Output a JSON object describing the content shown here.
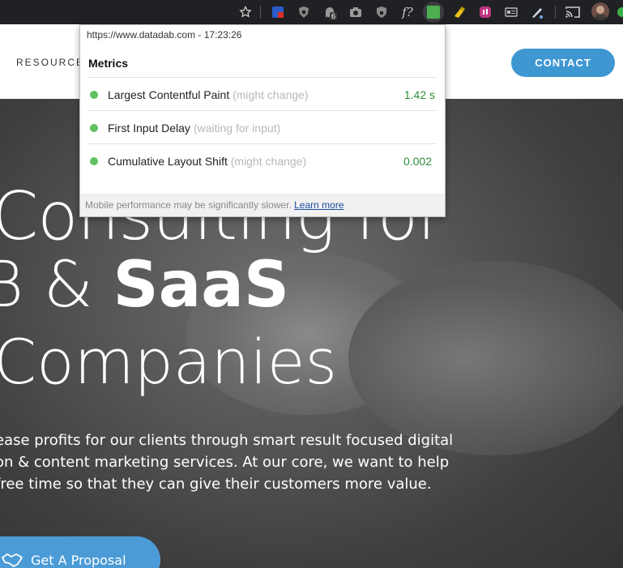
{
  "toolbar": {
    "icons": [
      "star-icon",
      "ublock-icon",
      "shield-icon",
      "ghostery-icon",
      "camera-icon",
      "privacy-shield-icon",
      "font-inspector-icon",
      "web-vitals-icon",
      "highlighter-icon",
      "instagram-icon",
      "reader-icon",
      "pen-icon",
      "cast-icon",
      "profile-avatar"
    ],
    "badge": "6",
    "font_ext": "f?"
  },
  "header": {
    "nav_resources": "RESOURCES",
    "contact": "CONTACT"
  },
  "popup": {
    "url": "https://www.datadab.com - 17:23:26",
    "heading": "Metrics",
    "metrics": [
      {
        "name": "Largest Contentful Paint",
        "note": "(might change)",
        "value": "1.42 s"
      },
      {
        "name": "First Input Delay",
        "note": "(waiting for input)",
        "value": ""
      },
      {
        "name": "Cumulative Layout Shift",
        "note": "(might change)",
        "value": "0.002"
      }
    ],
    "footer_text": "Mobile performance may be significantly slower.",
    "footer_link": "Learn more"
  },
  "hero": {
    "line1": "Consulting for",
    "line2_pre": "B & ",
    "line2_bold": "SaaS",
    "line3": "Companies",
    "text_lines": [
      "ease profits for our clients through smart result focused digital",
      "on & content marketing services. At our core, we want to help",
      "free time so that they can give their customers more value."
    ],
    "cta": "Get A Proposal"
  },
  "colors": {
    "toolbar_bg": "#202124",
    "accent_blue": "#3e97d1",
    "metric_good": "#5fc15f",
    "metric_value": "#2e8b3a"
  }
}
